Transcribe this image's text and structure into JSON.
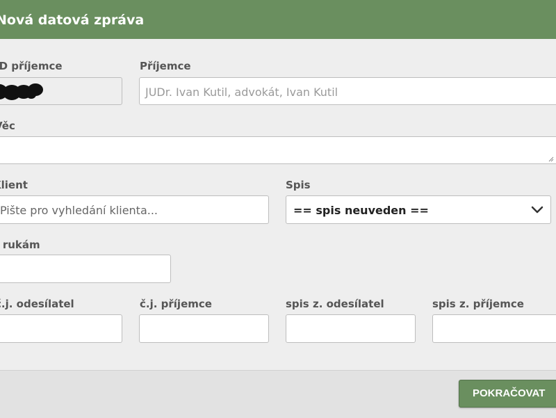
{
  "dialog": {
    "title": "Nová datová zpráva"
  },
  "form": {
    "id_recipient": {
      "label": "ID příjemce"
    },
    "recipient": {
      "label": "Příjemce",
      "value": "JUDr. Ivan Kutil, advokát, Ivan Kutil"
    },
    "subject": {
      "label": "Věc",
      "value": ""
    },
    "client": {
      "label": "Klient",
      "placeholder": "Pište pro vyhledání klienta..."
    },
    "file": {
      "label": "Spis",
      "selected": "== spis neuveden =="
    },
    "attention": {
      "label": "K rukám",
      "value": ""
    },
    "sender_ref": {
      "label": "č.j. odesílatel",
      "value": ""
    },
    "recipient_ref": {
      "label": "č.j. příjemce",
      "value": ""
    },
    "sender_file": {
      "label": "spis z. odesílatel",
      "value": ""
    },
    "recipient_file": {
      "label": "spis z. příjemce",
      "value": ""
    }
  },
  "footer": {
    "continue_label": "POKRAČOVAT"
  },
  "colors": {
    "header": "#6a8f5f",
    "button": "#6a8f5f"
  },
  "icons": {
    "select": "chevron-down-icon",
    "redaction": "redacted-marks"
  }
}
